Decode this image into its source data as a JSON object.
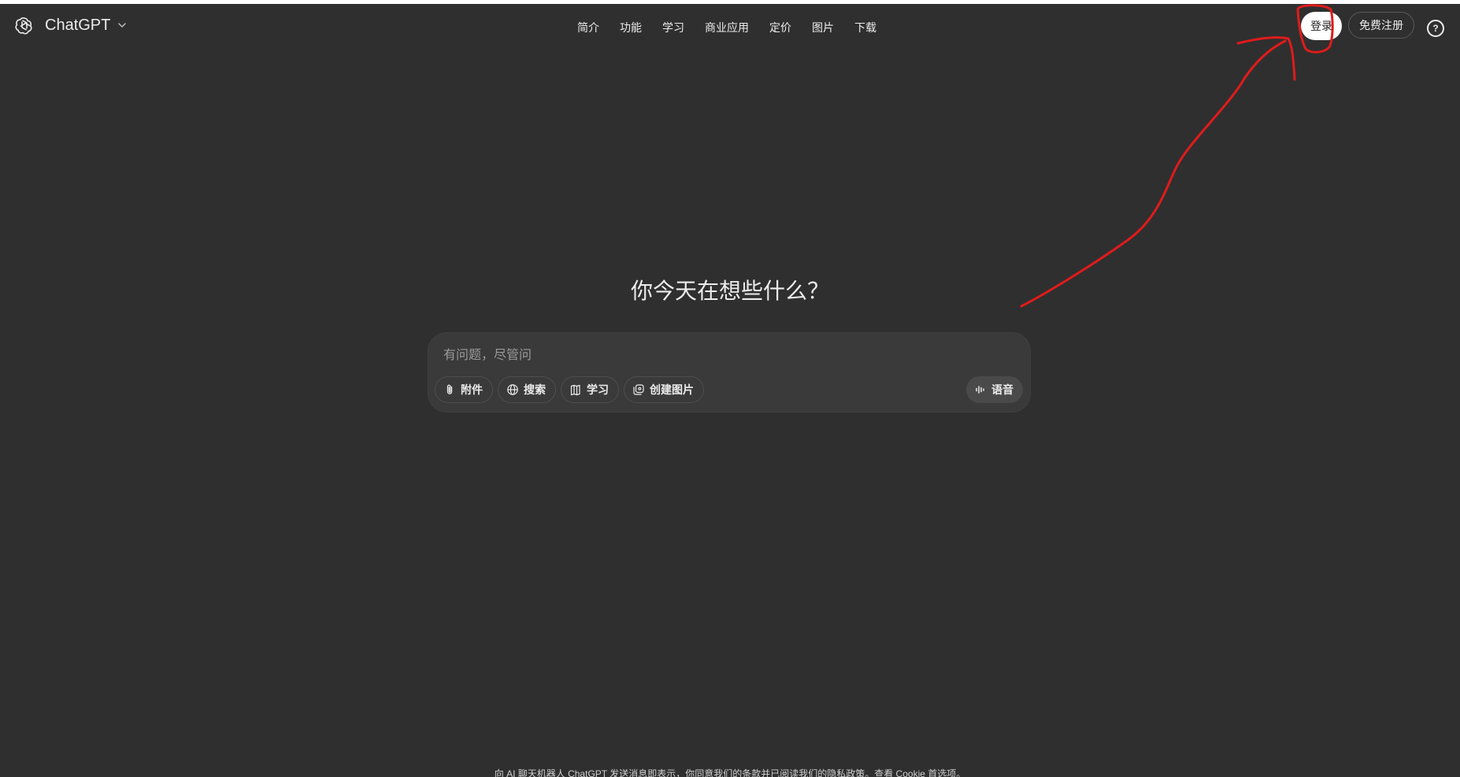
{
  "header": {
    "brand": "ChatGPT",
    "nav": [
      "简介",
      "功能",
      "学习",
      "商业应用",
      "定价",
      "图片",
      "下载"
    ],
    "login": "登录",
    "signup": "免费注册",
    "help": "?"
  },
  "main": {
    "heading": "你今天在想些什么？",
    "composer": {
      "placeholder": "有问题，尽管问",
      "tools": [
        "附件",
        "搜索",
        "学习",
        "创建图片"
      ],
      "voice": "语音"
    }
  },
  "footer": {
    "text": "向 AI 聊天机器人 ChatGPT 发送消息即表示，你同意我们的条款并已阅读我们的隐私政策。查看 Cookie 首选项。"
  },
  "colors": {
    "background": "#2f2f2f",
    "composer": "#3a3a3a",
    "annotation": "#e01b1b"
  },
  "icons": {
    "brand": "openai-logo-icon",
    "brand_menu": "chevron-down-icon",
    "help": "question-circle-icon",
    "tools": [
      "paperclip-icon",
      "globe-icon",
      "book-icon",
      "image-icon"
    ],
    "voice": "waveform-icon"
  }
}
